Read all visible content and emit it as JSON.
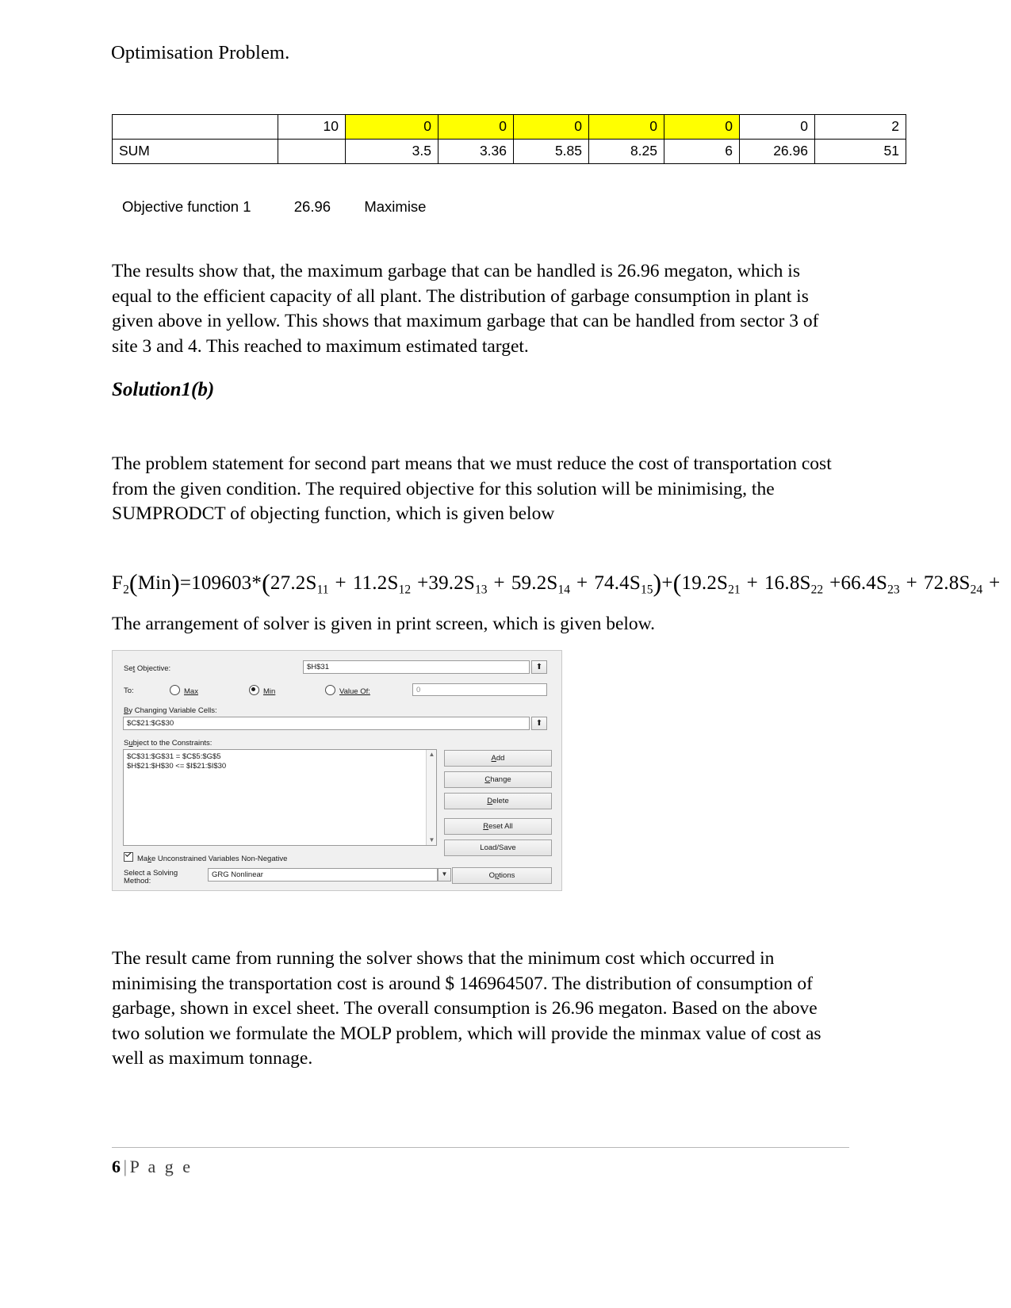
{
  "document": {
    "heading_top": "Optimisation Problem.",
    "section_heading": "Solution1(b)"
  },
  "table": {
    "rows": [
      {
        "cells": [
          {
            "text": "",
            "highlight": false,
            "align": "left"
          },
          {
            "text": "10",
            "highlight": false
          },
          {
            "text": "0",
            "highlight": true
          },
          {
            "text": "0",
            "highlight": true
          },
          {
            "text": "0",
            "highlight": true
          },
          {
            "text": "0",
            "highlight": true
          },
          {
            "text": "0",
            "highlight": true
          },
          {
            "text": "0",
            "highlight": false
          },
          {
            "text": "2",
            "highlight": false
          }
        ]
      },
      {
        "cells": [
          {
            "text": "SUM",
            "highlight": false,
            "align": "left"
          },
          {
            "text": "",
            "highlight": false
          },
          {
            "text": "3.5",
            "highlight": false
          },
          {
            "text": "3.36",
            "highlight": false
          },
          {
            "text": "5.85",
            "highlight": false
          },
          {
            "text": "8.25",
            "highlight": false
          },
          {
            "text": "6",
            "highlight": false
          },
          {
            "text": "26.96",
            "highlight": false
          },
          {
            "text": "51",
            "highlight": false
          }
        ]
      }
    ],
    "highlight_color": "#ffff00"
  },
  "objective": {
    "label": "Objective function 1",
    "value": "26.96",
    "direction": "Maximise"
  },
  "paragraphs": {
    "p1": "The results show that, the maximum garbage that can be handled is 26.96 megaton, which is equal to the efficient capacity of all plant. The distribution of garbage consumption in plant is given above in yellow. This shows that maximum garbage that can be handled from sector 3 of site 3 and 4. This reached to maximum estimated target.",
    "p2": "The problem statement for second part means that we must reduce the cost of transportation cost from the given condition. The required objective for this solution will be minimising, the SUMPRODCT of objecting function, which is given below",
    "p3": "The arrangement of solver is given in print screen, which is given below.",
    "p4": "The result came from running the solver shows that the minimum cost which occurred in minimising the transportation cost is around $ 146964507. The distribution of consumption of garbage, shown in excel sheet. The overall consumption is 26.96 megaton. Based on the above two solution we formulate the MOLP problem, which will provide the minmax value of cost as well as maximum tonnage."
  },
  "formula": {
    "lhs": "F",
    "lhs_sub": "2",
    "arg": "Min",
    "equals_coefficient": "=109603*",
    "group1": [
      {
        "coef": "27.2S",
        "sub": "11"
      },
      {
        "coef": "11.2S",
        "sub": "12"
      },
      {
        "coef": "39.2S",
        "sub": "13"
      },
      {
        "coef": "59.2S",
        "sub": "14"
      },
      {
        "coef": "74.4S",
        "sub": "15"
      }
    ],
    "group2": [
      {
        "coef": "19.2S",
        "sub": "21"
      },
      {
        "coef": "16.8S",
        "sub": "22"
      },
      {
        "coef": "66.4S",
        "sub": "23"
      },
      {
        "coef": "72.8S",
        "sub": "24"
      }
    ],
    "trailing": "+"
  },
  "solver": {
    "set_objective_label": "Set Objective:",
    "set_objective_value": "$H$31",
    "to_label": "To:",
    "radios": [
      {
        "label": "Max",
        "selected": false
      },
      {
        "label": "Min",
        "selected": true
      },
      {
        "label": "Value Of:",
        "selected": false
      }
    ],
    "value_of_field": "0",
    "changing_cells_label": "By Changing Variable Cells:",
    "changing_cells_value": "$C$21:$G$30",
    "constraints_label": "Subject to the Constraints:",
    "constraints": [
      "$C$31:$G$31 = $C$5:$G$5",
      "$H$21:$H$30 <= $I$21:$I$30"
    ],
    "buttons": [
      "Add",
      "Change",
      "Delete",
      "Reset All",
      "Load/Save"
    ],
    "checkbox_label": "Make Unconstrained Variables Non-Negative",
    "checkbox_checked": true,
    "method_label_line1": "Select a Solving",
    "method_label_line2": "Method:",
    "method_value": "GRG Nonlinear",
    "options_button": "Options",
    "picker_icon": "range-picker-icon"
  },
  "footer": {
    "page_number": "6",
    "separator": "|",
    "word": "P a g e"
  }
}
